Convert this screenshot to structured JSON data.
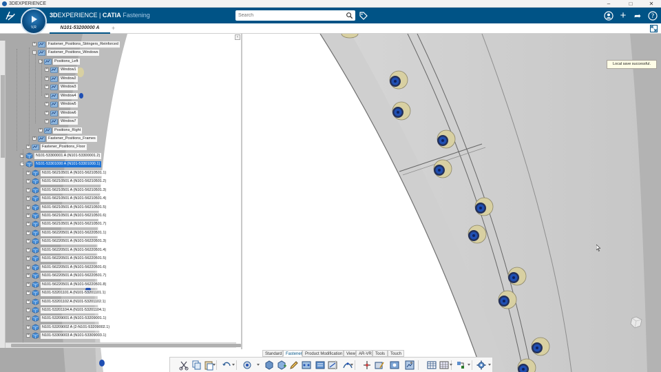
{
  "os": {
    "title": "3DEXPERIENCE",
    "minimize": "–",
    "maximize": "□",
    "close": "✕"
  },
  "header": {
    "brand_bold": "3D",
    "brand_rest": "EXPERIENCE",
    "brand_sep": " | ",
    "brand_app": "CATIA",
    "brand_sub": " Fastening",
    "compass_label": "V,R",
    "search_placeholder": "Search",
    "icons": [
      "3ds-logo",
      "search-icon",
      "tag-icon",
      "user-icon",
      "plus-icon",
      "share-icon",
      "help-icon"
    ],
    "plus_glyph": "+",
    "help_glyph": "?",
    "share_glyph": "➦"
  },
  "tabs": {
    "active": "N101-53200000 A",
    "add": "+"
  },
  "tree": {
    "rows": [
      {
        "label": "Fastener_Positions_Stringers_Reinforced",
        "level": 3,
        "expander": "+",
        "icon": "fastener-set-icon"
      },
      {
        "label": "Fastener_Positions_Windows",
        "level": 3,
        "expander": "−",
        "icon": "fastener-set-icon"
      },
      {
        "label": "Positions_Left",
        "level": 4,
        "expander": "−",
        "icon": "fastener-set-icon"
      },
      {
        "label": "Window1",
        "level": 5,
        "expander": "+",
        "icon": "fastener-set-icon"
      },
      {
        "label": "Window2",
        "level": 5,
        "expander": "+",
        "icon": "fastener-set-icon"
      },
      {
        "label": "Window3",
        "level": 5,
        "expander": "+",
        "icon": "fastener-set-icon"
      },
      {
        "label": "Window4",
        "level": 5,
        "expander": "+",
        "icon": "fastener-set-icon"
      },
      {
        "label": "Window5",
        "level": 5,
        "expander": "+",
        "icon": "fastener-set-icon"
      },
      {
        "label": "Window6",
        "level": 5,
        "expander": "+",
        "icon": "fastener-set-icon"
      },
      {
        "label": "Window7",
        "level": 5,
        "expander": "+",
        "icon": "fastener-set-icon"
      },
      {
        "label": "Positions_Right",
        "level": 4,
        "expander": "+",
        "icon": "fastener-set-icon"
      },
      {
        "label": "Fastener_Positions_Frames",
        "level": 3,
        "expander": "+",
        "icon": "fastener-set-icon"
      },
      {
        "label": "Fastener_Positions_Floor",
        "level": 2,
        "expander": "+",
        "icon": "fastener-set-icon"
      },
      {
        "label": "N101-53300001 A (N101-53300001.2)",
        "level": 1,
        "expander": "+",
        "icon": "product-icon"
      },
      {
        "label": "N101-53301000 A (N101-53301000.1)",
        "level": 1,
        "expander": "−",
        "icon": "product-icon",
        "selected": true
      },
      {
        "label": "N101-56210501 A (N101-56210501.1)",
        "level": 2,
        "expander": "+",
        "icon": "product-icon"
      },
      {
        "label": "N101-56210501 A (N101-56210501.2)",
        "level": 2,
        "expander": "+",
        "icon": "product-icon"
      },
      {
        "label": "N101-56210501 A (N101-56210501.3)",
        "level": 2,
        "expander": "+",
        "icon": "product-icon"
      },
      {
        "label": "N101-56210501 A (N101-56210501.4)",
        "level": 2,
        "expander": "+",
        "icon": "product-icon"
      },
      {
        "label": "N101-56210501 A (N101-56210501.5)",
        "level": 2,
        "expander": "+",
        "icon": "product-icon"
      },
      {
        "label": "N101-56210501 A (N101-56210501.6)",
        "level": 2,
        "expander": "+",
        "icon": "product-icon"
      },
      {
        "label": "N101-56210501 A (N101-56210501.7)",
        "level": 2,
        "expander": "+",
        "icon": "product-icon"
      },
      {
        "label": "N101-56220501 A (N101-56220501.1)",
        "level": 2,
        "expander": "+",
        "icon": "product-icon"
      },
      {
        "label": "N101-56220501 A (N101-56220501.3)",
        "level": 2,
        "expander": "+",
        "icon": "product-icon"
      },
      {
        "label": "N101-56220501 A (N101-56220501.4)",
        "level": 2,
        "expander": "+",
        "icon": "product-icon"
      },
      {
        "label": "N101-56220501 A (N101-56220501.5)",
        "level": 2,
        "expander": "+",
        "icon": "product-icon"
      },
      {
        "label": "N101-56220501 A (N101-56220501.6)",
        "level": 2,
        "expander": "+",
        "icon": "product-icon"
      },
      {
        "label": "N101-56220501 A (N101-56220501.7)",
        "level": 2,
        "expander": "+",
        "icon": "product-icon"
      },
      {
        "label": "N101-56220501 A (N101-56220501.8)",
        "level": 2,
        "expander": "+",
        "icon": "product-icon"
      },
      {
        "label": "N101-53201101 A (N101-53201101.1)",
        "level": 2,
        "expander": "+",
        "icon": "product-icon"
      },
      {
        "label": "N101-53201102 A (N101-53201102.1)",
        "level": 2,
        "expander": "+",
        "icon": "product-icon"
      },
      {
        "label": "N101-53201104 A (N101-53201104.1)",
        "level": 2,
        "expander": "+",
        "icon": "product-icon"
      },
      {
        "label": "N101-53209001 A (N101-53209001.1)",
        "level": 2,
        "expander": "+",
        "icon": "product-icon"
      },
      {
        "label": "N101-53209002 A (2-N101-53209002.1)",
        "level": 2,
        "expander": "+",
        "icon": "product-icon"
      },
      {
        "label": "N101-53309003 A (N101-53309003.1)",
        "level": 2,
        "expander": "+",
        "icon": "product-icon"
      }
    ],
    "collapse_glyph": "‹"
  },
  "toast": {
    "message": "Local save successful."
  },
  "action_bar": {
    "tabs": [
      {
        "label": "Standard"
      },
      {
        "label": "Fastener",
        "active": true
      },
      {
        "label": "Product Modification"
      },
      {
        "label": "View"
      },
      {
        "label": "AR-VR"
      },
      {
        "label": "Tools"
      },
      {
        "label": "Touch"
      }
    ],
    "handle_glyph": "⌄",
    "buttons": [
      "cut-icon",
      "copy-icon",
      "paste-icon",
      "undo-icon",
      "fastener-add-icon",
      "part-icon",
      "part-insert-icon",
      "pencil-icon",
      "fastener-pattern-icon",
      "fastener-batch-icon",
      "fastener-projection-icon",
      "fastener-route-icon",
      "measure-icon",
      "fastener-edit-icon",
      "fastener-review-icon",
      "fastener-report-icon",
      "layer-icon",
      "table-icon",
      "grid-icon",
      "fastener-tools-icon",
      "settings-gear-icon"
    ]
  },
  "colors": {
    "topbar": "#005386",
    "selection": "#1f74d6",
    "fuselage": "#d4d4d4",
    "fastener_collar": "#d8d0a2",
    "fastener_core": "#1f4fb3"
  }
}
